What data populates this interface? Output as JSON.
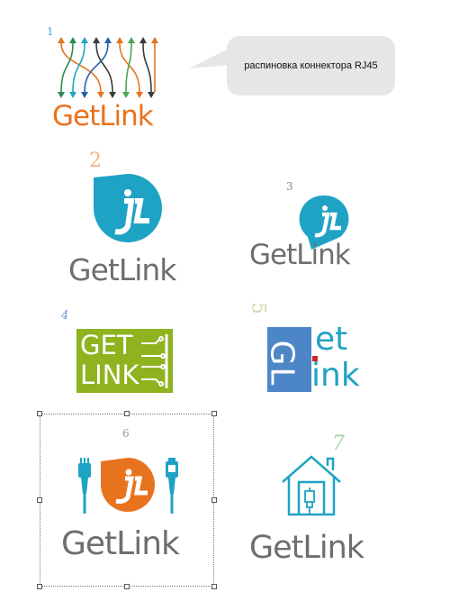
{
  "labels": {
    "n1": "1",
    "n2": "2",
    "n3": "3",
    "n4": "4",
    "n5": "5",
    "n6": "6",
    "n7": "7"
  },
  "callout": {
    "text": "распиновка коннектора RJ45"
  },
  "logos": {
    "logo1": {
      "brand": "GetLink"
    },
    "logo2": {
      "brand": "GetLink"
    },
    "logo3": {
      "brand": "GetLink"
    },
    "logo4": {
      "line1": "GET",
      "line2": "LINK"
    },
    "logo5": {
      "left": "GL",
      "top": "et",
      "bottom": "ink"
    },
    "logo6": {
      "brand": "GetLink"
    },
    "logo7": {
      "brand": "GetLink"
    }
  },
  "colors": {
    "orange": "#e8731e",
    "teal": "#1fa3c4",
    "gray": "#6e6e6e",
    "green": "#8fb31f",
    "blue": "#4d86c6",
    "red": "#d6231f"
  }
}
